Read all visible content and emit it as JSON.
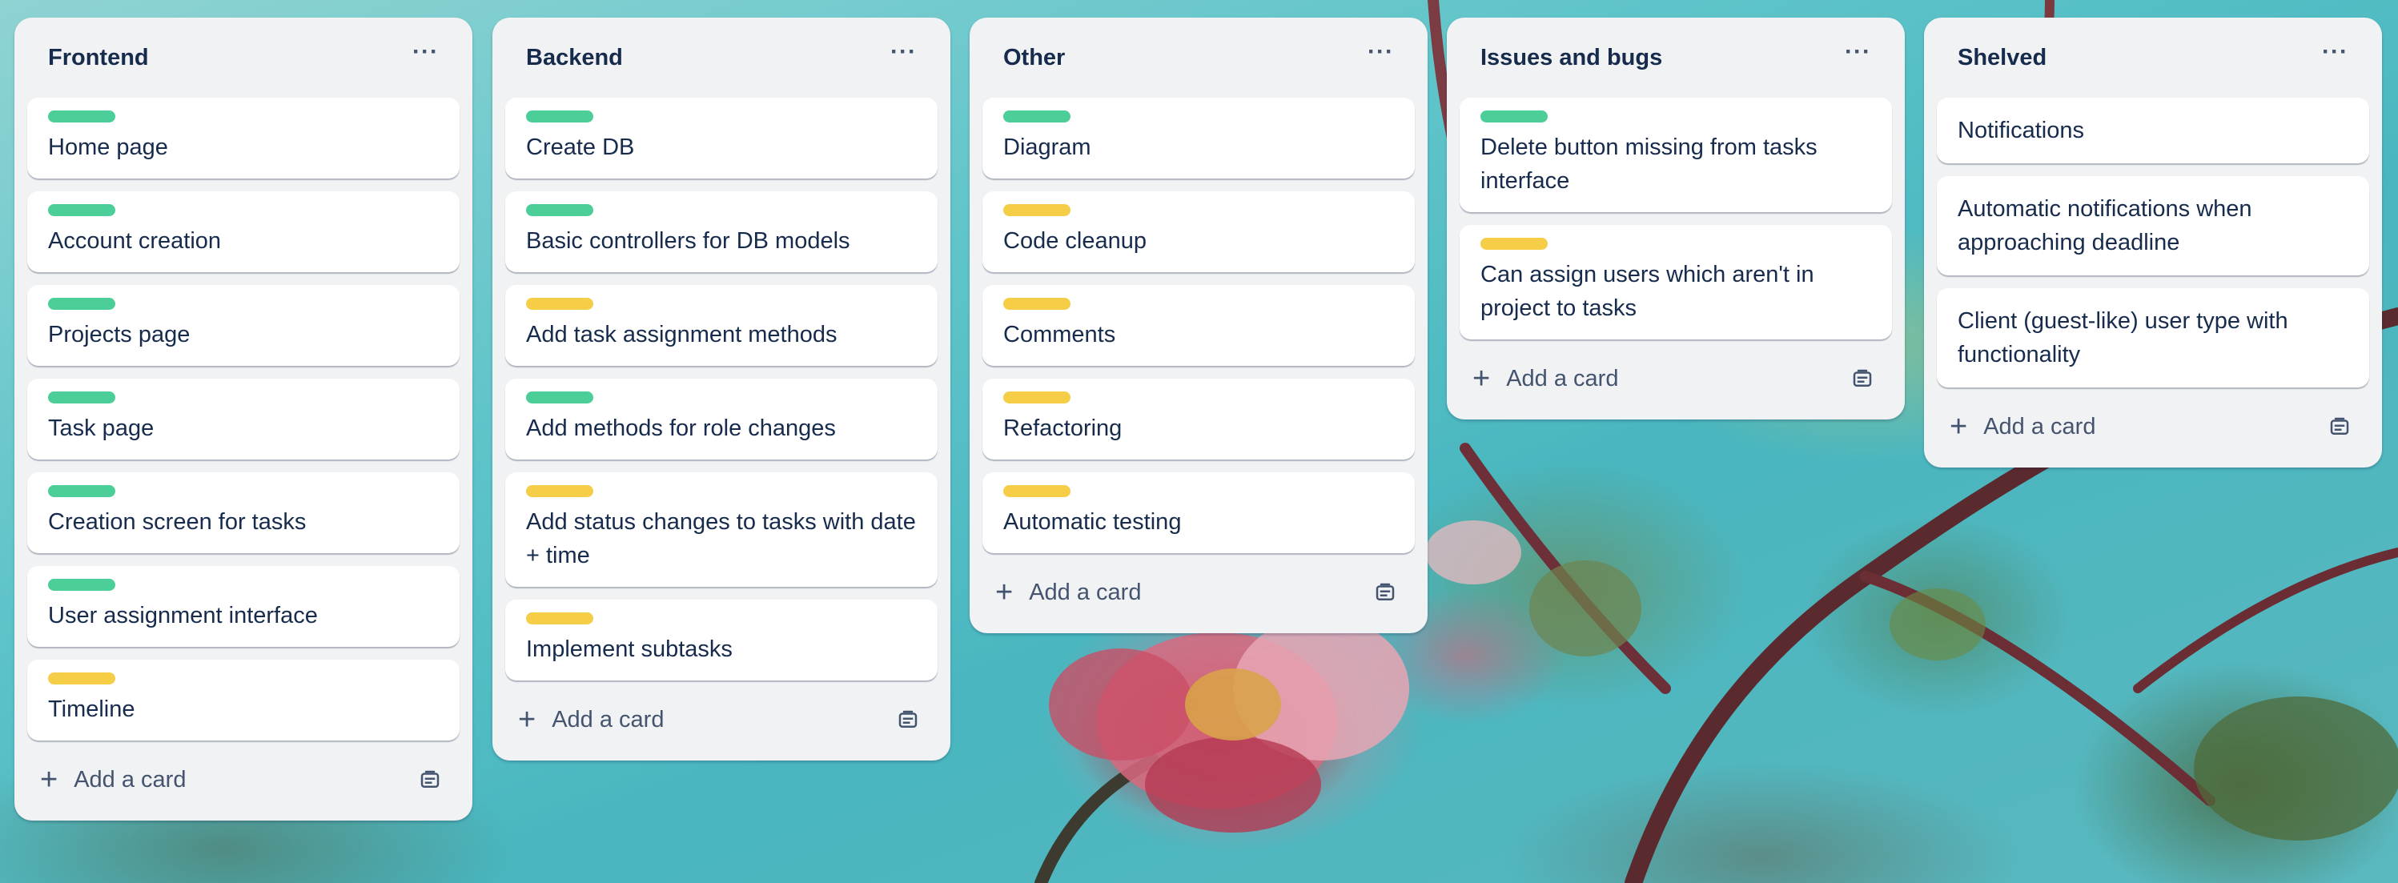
{
  "lists": [
    {
      "title": "Frontend",
      "menu": "···",
      "cards": [
        {
          "label": "green",
          "title": "Home page"
        },
        {
          "label": "green",
          "title": "Account creation"
        },
        {
          "label": "green",
          "title": "Projects page"
        },
        {
          "label": "green",
          "title": "Task page"
        },
        {
          "label": "green",
          "title": "Creation screen for tasks"
        },
        {
          "label": "green",
          "title": "User assignment interface"
        },
        {
          "label": "yellow",
          "title": "Timeline"
        }
      ],
      "add_card": "Add a card"
    },
    {
      "title": "Backend",
      "menu": "···",
      "cards": [
        {
          "label": "green",
          "title": "Create DB"
        },
        {
          "label": "green",
          "title": "Basic controllers for DB models"
        },
        {
          "label": "yellow",
          "title": "Add task assignment methods"
        },
        {
          "label": "green",
          "title": "Add methods for role changes"
        },
        {
          "label": "yellow",
          "title": "Add status changes to tasks with date + time"
        },
        {
          "label": "yellow",
          "title": "Implement subtasks"
        }
      ],
      "add_card": "Add a card"
    },
    {
      "title": "Other",
      "menu": "···",
      "cards": [
        {
          "label": "green",
          "title": "Diagram"
        },
        {
          "label": "yellow",
          "title": "Code cleanup"
        },
        {
          "label": "yellow",
          "title": "Comments"
        },
        {
          "label": "yellow",
          "title": "Refactoring"
        },
        {
          "label": "yellow",
          "title": "Automatic testing"
        }
      ],
      "add_card": "Add a card"
    },
    {
      "title": "Issues and bugs",
      "menu": "···",
      "cards": [
        {
          "label": "green",
          "title": "Delete button missing from tasks interface"
        },
        {
          "label": "yellow",
          "title": "Can assign users which aren't in project to tasks"
        }
      ],
      "add_card": "Add a card"
    },
    {
      "title": "Shelved",
      "menu": "···",
      "cards": [
        {
          "label": "",
          "title": "Notifications"
        },
        {
          "label": "",
          "title": "Automatic notifications when approaching deadline"
        },
        {
          "label": "",
          "title": "Client (guest-like) user type with functionality"
        }
      ],
      "add_card": "Add a card"
    }
  ],
  "icons": {
    "list_menu": "more-horizontal-icon",
    "add": "plus-icon",
    "template": "card-template-icon"
  },
  "colors": {
    "label_green": "#4bce97",
    "label_yellow": "#f5cd47",
    "list_bg": "#f1f2f4",
    "text": "#172b4d"
  }
}
